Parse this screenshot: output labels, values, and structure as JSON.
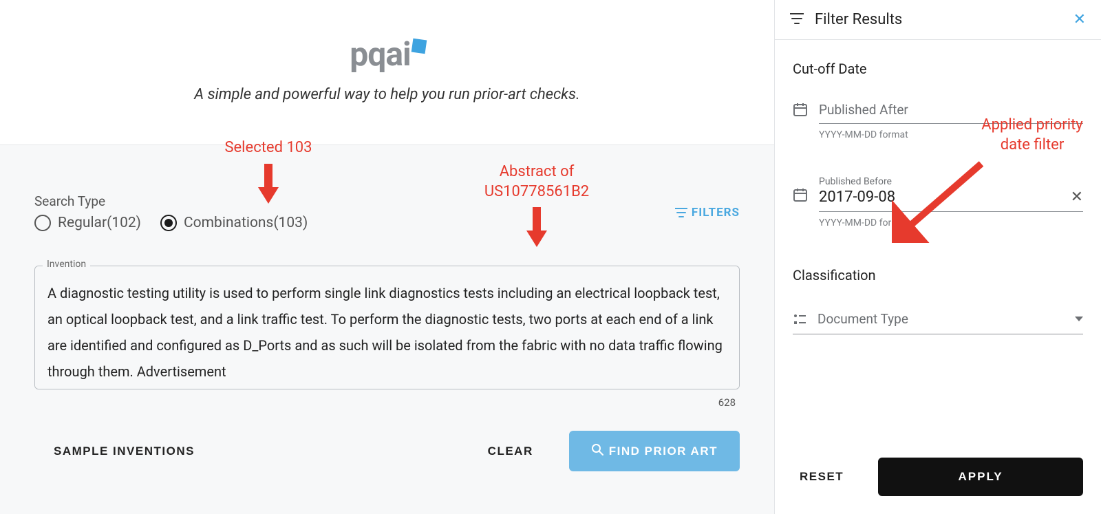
{
  "brand": {
    "name": "pqai"
  },
  "tagline": "A simple and powerful way to help you run prior-art checks.",
  "search": {
    "type_label": "Search Type",
    "options": {
      "regular": "Regular(102)",
      "combinations": "Combinations(103)"
    },
    "selected": "combinations",
    "filters_link": "FILTERS",
    "invention_label": "Invention",
    "invention_text": "A diagnostic testing utility is used to perform single link diagnostics tests including an electrical loopback test, an optical loopback test, and a link traffic test. To perform the diagnostic tests, two ports at each end of a link are identified and configured as D_Ports and as such will be isolated from the fabric with no data traffic flowing through them. Advertisement",
    "char_count": "628"
  },
  "buttons": {
    "sample": "SAMPLE INVENTIONS",
    "clear": "CLEAR",
    "find": "FIND PRIOR ART",
    "reset": "RESET",
    "apply": "APPLY"
  },
  "panel": {
    "title": "Filter Results",
    "cutoff_heading": "Cut-off Date",
    "after": {
      "label": "Published After",
      "value": "",
      "hint": "YYYY-MM-DD format"
    },
    "before": {
      "label": "Published Before",
      "value": "2017-09-08",
      "hint": "YYYY-MM-DD format"
    },
    "classification_heading": "Classification",
    "doc_type_label": "Document Type"
  },
  "annotations": {
    "selected_103": "Selected 103",
    "abstract_line1": "Abstract of",
    "abstract_line2": "US10778561B2",
    "priority_line1": "Applied priority",
    "priority_line2": "date filter"
  }
}
